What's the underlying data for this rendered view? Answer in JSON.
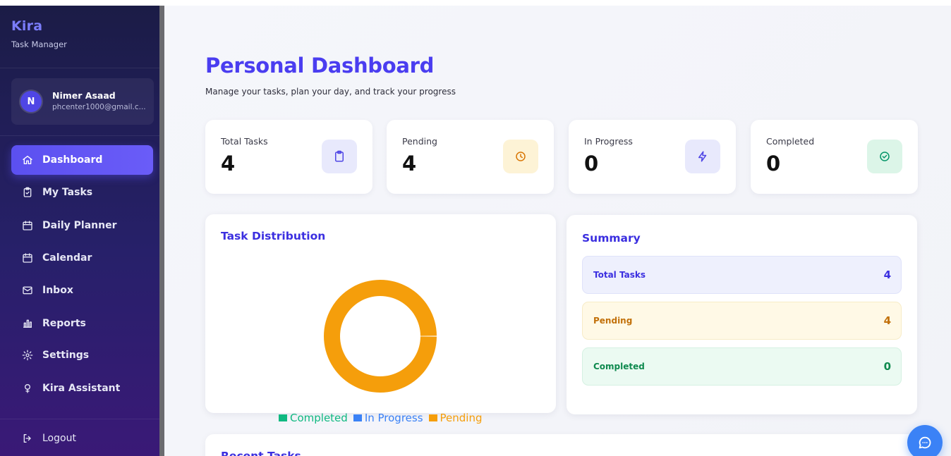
{
  "brand": {
    "name": "Kira",
    "subtitle": "Task Manager"
  },
  "user": {
    "initial": "N",
    "name": "Nimer Asaad",
    "email": "phcenter1000@gmail.c..."
  },
  "nav": {
    "items": [
      {
        "label": "Dashboard",
        "icon": "home-icon",
        "active": true
      },
      {
        "label": "My Tasks",
        "icon": "clipboard-icon",
        "active": false
      },
      {
        "label": "Daily Planner",
        "icon": "calendar-icon",
        "active": false
      },
      {
        "label": "Calendar",
        "icon": "calendar-icon",
        "active": false
      },
      {
        "label": "Inbox",
        "icon": "mail-icon",
        "active": false
      },
      {
        "label": "Reports",
        "icon": "bar-chart-icon",
        "active": false
      },
      {
        "label": "Settings",
        "icon": "gear-icon",
        "active": false
      },
      {
        "label": "Kira Assistant",
        "icon": "lightbulb-icon",
        "active": false
      }
    ],
    "logout_label": "Logout"
  },
  "header": {
    "title": "Personal Dashboard",
    "subtitle": "Manage your tasks, plan your day, and track your progress"
  },
  "stats": [
    {
      "label": "Total Tasks",
      "value": "4",
      "icon": "clipboard-icon",
      "icon_color": "#4f46e5",
      "icon_bg": "#e8e9fc"
    },
    {
      "label": "Pending",
      "value": "4",
      "icon": "clock-icon",
      "icon_color": "#d97706",
      "icon_bg": "#fdf3d6"
    },
    {
      "label": "In Progress",
      "value": "0",
      "icon": "lightning-icon",
      "icon_color": "#4f46e5",
      "icon_bg": "#e8e9fc"
    },
    {
      "label": "Completed",
      "value": "0",
      "icon": "check-circle-icon",
      "icon_color": "#059669",
      "icon_bg": "#dcf5e8"
    }
  ],
  "distribution": {
    "title": "Task Distribution",
    "legend": [
      {
        "label": "Completed",
        "color": "#10b981"
      },
      {
        "label": "In Progress",
        "color": "#3b82f6"
      },
      {
        "label": "Pending",
        "color": "#f59e0b"
      }
    ]
  },
  "chart_data": {
    "type": "pie",
    "categories": [
      "Completed",
      "In Progress",
      "Pending"
    ],
    "values": [
      0,
      0,
      4
    ],
    "colors": [
      "#10b981",
      "#3b82f6",
      "#f59e0b"
    ],
    "title": "Task Distribution",
    "donut": true,
    "legend_position": "bottom"
  },
  "summary": {
    "title": "Summary",
    "rows": [
      {
        "label": "Total Tasks",
        "value": "4",
        "text_color": "#3b2fe0",
        "bg": "#eef0fd",
        "border": "#dfe2fa"
      },
      {
        "label": "Pending",
        "value": "4",
        "text_color": "#c2700a",
        "bg": "#fff9e6",
        "border": "#f7ecc7"
      },
      {
        "label": "Completed",
        "value": "0",
        "text_color": "#0f8a4f",
        "bg": "#ebfaf2",
        "border": "#d5f1e2"
      }
    ]
  },
  "recent": {
    "title": "Recent Tasks"
  },
  "chat": {
    "icon": "chat-bubble-icon",
    "color": "#3b82f6"
  }
}
